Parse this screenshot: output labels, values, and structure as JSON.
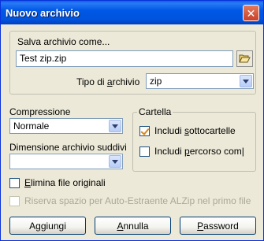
{
  "window": {
    "title": "Nuovo archivio",
    "close_glyph": "✕"
  },
  "save_as": {
    "label": "Salva archivio come...",
    "filename": "Test zip.zip",
    "folder_icon": "open-folder-icon",
    "type_label_pre": "Tipo di ",
    "type_label_accel": "a",
    "type_label_post": "rchivio",
    "type_value": "zip"
  },
  "compression": {
    "label": "Compressione",
    "value": "Normale"
  },
  "archive_size": {
    "label": "Dimensione archivio suddivi",
    "value": ""
  },
  "folder_group": {
    "label": "Cartella",
    "include_subfolders": {
      "pre": "Includi ",
      "accel": "s",
      "post": "ottocartelle",
      "checked": true
    },
    "include_path": {
      "pre": "Includi ",
      "accel": "p",
      "post": "ercorso com|",
      "checked": false
    }
  },
  "delete_originals": {
    "pre": "",
    "accel": "E",
    "post": "limina file originali",
    "checked": false
  },
  "reserve_space": {
    "label": "Riserva spazio per Auto-Estraente ALZip nel primo file",
    "checked": false,
    "disabled": true
  },
  "buttons": {
    "add": {
      "pre": "A",
      "accel": "g",
      "post": "giungi"
    },
    "cancel": {
      "pre": "",
      "accel": "A",
      "post": "nnulla"
    },
    "password": {
      "pre": "",
      "accel": "P",
      "post": "assword"
    }
  },
  "colors": {
    "title_bar": "#0058e6",
    "window_bg": "#ece9d8",
    "check_mark": "#d9861c"
  }
}
